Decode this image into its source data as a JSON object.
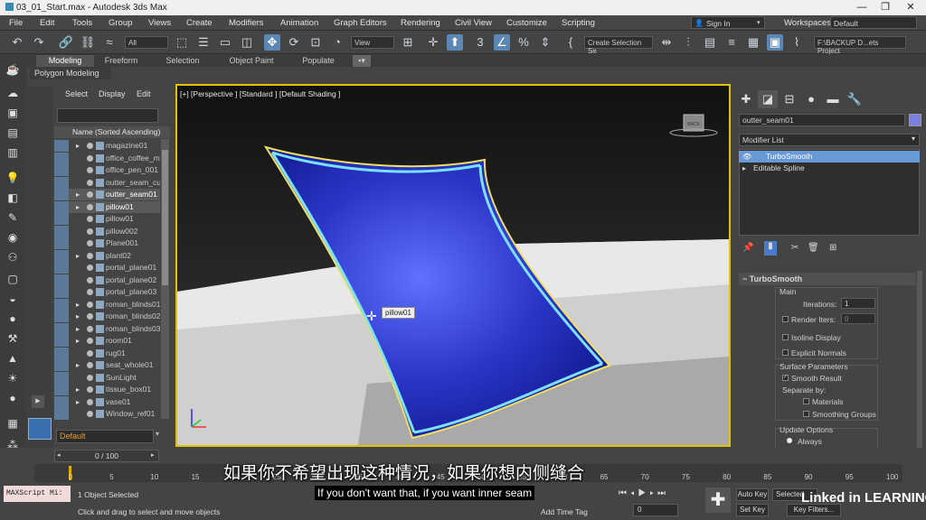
{
  "window": {
    "title": "03_01_Start.max - Autodesk 3ds Max",
    "controls": [
      "—",
      "❐",
      "✕"
    ]
  },
  "menu": [
    "File",
    "Edit",
    "Tools",
    "Group",
    "Views",
    "Create",
    "Modifiers",
    "Animation",
    "Graph Editors",
    "Rendering",
    "Civil View",
    "Customize",
    "Scripting"
  ],
  "signin": {
    "label": "Sign In",
    "workspaces_label": "Workspaces:",
    "workspaces_value": "Default"
  },
  "toolbar": {
    "filter_value": "All",
    "coord_value": "View",
    "selection_set": "Create Selection Se",
    "path": "F:\\BACKUP D...ets Project"
  },
  "ribbon": {
    "tabs": [
      "Modeling",
      "Freeform",
      "Selection",
      "Object Paint",
      "Populate"
    ],
    "sub": "Polygon Modeling"
  },
  "scene_explorer": {
    "menu": [
      "Select",
      "Display",
      "Edit"
    ],
    "header": "Name (Sorted Ascending)",
    "rows": [
      {
        "name": "magazine01",
        "expand": "▸"
      },
      {
        "name": "office_coffee_m",
        "expand": ""
      },
      {
        "name": "office_pen_001",
        "expand": ""
      },
      {
        "name": "outter_seam_cu",
        "expand": ""
      },
      {
        "name": "outter_seam01",
        "expand": "▸"
      },
      {
        "name": "pillow01",
        "expand": "▸"
      },
      {
        "name": "pillow01",
        "expand": ""
      },
      {
        "name": "pillow002",
        "expand": ""
      },
      {
        "name": "Plane001",
        "expand": ""
      },
      {
        "name": "plant02",
        "expand": "▸"
      },
      {
        "name": "portal_plane01",
        "expand": ""
      },
      {
        "name": "portal_plane02",
        "expand": ""
      },
      {
        "name": "portal_plane03",
        "expand": ""
      },
      {
        "name": "roman_blinds01",
        "expand": "▸"
      },
      {
        "name": "roman_blinds02",
        "expand": "▸"
      },
      {
        "name": "roman_blinds03",
        "expand": "▸"
      },
      {
        "name": "room01",
        "expand": "▸"
      },
      {
        "name": "rug01",
        "expand": ""
      },
      {
        "name": "seat_whole01",
        "expand": "▸"
      },
      {
        "name": "SunLight",
        "expand": ""
      },
      {
        "name": "tissue_box01",
        "expand": "▸"
      },
      {
        "name": "vase01",
        "expand": "▸"
      },
      {
        "name": "Window_ref01",
        "expand": ""
      }
    ],
    "layer": "Default"
  },
  "viewport": {
    "label": "[+] [Perspective ] [Standard ] [Default Shading ]",
    "tooltip": "pillow01",
    "pillow_color": "#2a35c8",
    "cube_label": "BACK"
  },
  "command_panel": {
    "object_name": "outter_seam01",
    "object_color": "#7a7fe0",
    "modifier_list": "Modifier List",
    "stack": [
      "TurboSmooth",
      "Editable Spline"
    ],
    "rollout": "TurboSmooth",
    "main": "Main",
    "iterations_label": "Iterations:",
    "iterations_value": "1",
    "render_iters_label": "Render Iters:",
    "render_iters_value": "0",
    "isoline": "Isoline Display",
    "explicit": "Explicit Normals",
    "surface_params": "Surface Parameters",
    "smooth_result": "Smooth Result",
    "separate_by": "Separate by:",
    "materials": "Materials",
    "smoothing_groups": "Smoothing Groups",
    "update_options": "Update Options",
    "always": "Always"
  },
  "timeline": {
    "frame": "0 / 100",
    "ticks": [
      "0",
      "5",
      "10",
      "15",
      "20",
      "25",
      "30",
      "35",
      "40",
      "45",
      "50",
      "55",
      "60",
      "65",
      "70",
      "75",
      "80",
      "85",
      "90",
      "95",
      "100"
    ]
  },
  "status": {
    "maxscript": "MAXScript Mi:",
    "selected": "1 Object Selected",
    "prompt": "Click and drag to select and move objects",
    "add_time_tag": "Add Time Tag",
    "auto_key": "Auto Key",
    "set_key": "Set Key",
    "selected_dd": "Selected",
    "key_filters": "Key Filters...",
    "frame_value": "0"
  },
  "subtitles": {
    "cn": "如果你不希望出现这种情况，如果你想内侧缝合",
    "en": "If you don't want that, if you want inner seam"
  },
  "watermark": "Linked in LEARNING"
}
